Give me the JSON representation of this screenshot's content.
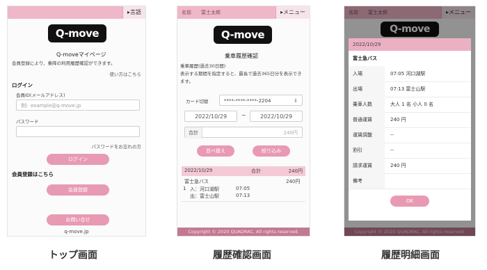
{
  "top": {
    "lang_button": "▸言語",
    "title": "Q-moveマイページ",
    "desc": "会員登録により、乗降の利用履歴確認ができます。",
    "howto_link": "使い方はこちら",
    "login_heading": "ログイン",
    "id_label": "会員ID(メールアドレス)",
    "id_placeholder": "例）example@q-move.jp",
    "password_label": "パスワード",
    "forgot_link": "パスワードをお忘れの方",
    "login_button": "ログイン",
    "signup_heading": "会員登録はこちら",
    "signup_button": "会員登録",
    "contact_button": "お問い合せ",
    "footer": "q-move.jp",
    "caption": "トップ画面"
  },
  "history": {
    "name_label": "名前　　富士太郎",
    "menu_button": "▸メニュー",
    "title": "乗車履歴確認",
    "desc1": "乗車履歴(過去30日間)",
    "desc2": "表示する期間を指定すると、最長で過去365日分を表示でき",
    "desc3": "ます。",
    "card_label": "カード切替",
    "card_value": "****-****-****-2204",
    "date_from": "2022/10/29",
    "date_sep": "~",
    "date_to": "2022/10/29",
    "total_label": "合計",
    "total_value": "240円",
    "sort_button": "並べ替え",
    "filter_button": "絞り込み",
    "result_date": "2022/10/29",
    "result_total_label": "合計",
    "result_total_value": "240円",
    "result_company": "富士急バス",
    "result_amount": "240円",
    "result_index": "1",
    "result_in": "入：河口湖駅",
    "result_in_time": "07:05",
    "result_out": "出：富士山駅",
    "result_out_time": "07:13",
    "footer": "Copyright © 2020 QUADRAC. All rights reserved.",
    "caption": "履歴確認画面"
  },
  "detail": {
    "name_label": "名前　　富士太郎",
    "menu_button": "▸メニュー",
    "date": "2022/10/29",
    "company": "富士急バス",
    "rows": [
      {
        "label": "入場",
        "value": "07:05 河口湖駅"
      },
      {
        "label": "出場",
        "value": "07:13 富士山駅"
      },
      {
        "label": "乗車人数",
        "value": "大人 1 名 小人 0 名"
      },
      {
        "label": "普通運賃",
        "value": "240 円"
      },
      {
        "label": "運賃調整",
        "value": "--"
      },
      {
        "label": "割引",
        "value": "--"
      },
      {
        "label": "請求運賃",
        "value": "240 円"
      },
      {
        "label": "備考",
        "value": ""
      }
    ],
    "ok_button": "OK",
    "footer": "Copyright © 2020 QUADRAC. All rights reserved.",
    "caption": "履歴明細画面"
  },
  "logo_text": "Q-move",
  "colors": {
    "accent": "#e89ab3",
    "band": "#efb7c8"
  }
}
